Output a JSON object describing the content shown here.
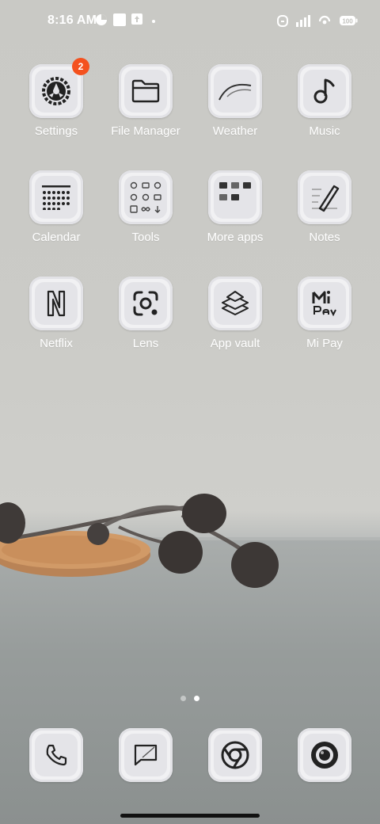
{
  "status_bar": {
    "time": "8:16 AM",
    "battery": "100"
  },
  "badge_count": "2",
  "apps": [
    {
      "label": "Settings",
      "icon": "settings-icon"
    },
    {
      "label": "File Manager",
      "icon": "folder-icon"
    },
    {
      "label": "Weather",
      "icon": "weather-icon"
    },
    {
      "label": "Music",
      "icon": "music-note-icon"
    },
    {
      "label": "Calendar",
      "icon": "calendar-icon"
    },
    {
      "label": "Tools",
      "icon": "tools-folder-icon"
    },
    {
      "label": "More apps",
      "icon": "more-apps-folder-icon"
    },
    {
      "label": "Notes",
      "icon": "notes-pen-icon"
    },
    {
      "label": "Netflix",
      "icon": "netflix-icon"
    },
    {
      "label": "Lens",
      "icon": "lens-icon"
    },
    {
      "label": "App vault",
      "icon": "app-vault-icon"
    },
    {
      "label": "Mi Pay",
      "icon": "mi-pay-icon"
    }
  ],
  "dock": [
    {
      "name": "phone",
      "icon": "phone-icon"
    },
    {
      "name": "messages",
      "icon": "message-icon"
    },
    {
      "name": "chrome",
      "icon": "chrome-icon"
    },
    {
      "name": "camera",
      "icon": "camera-icon"
    }
  ],
  "pages": {
    "count": 2,
    "active": 2
  },
  "colors": {
    "badge": "#f4511e",
    "label": "#ffffff",
    "tile": "#f1f1f3"
  }
}
